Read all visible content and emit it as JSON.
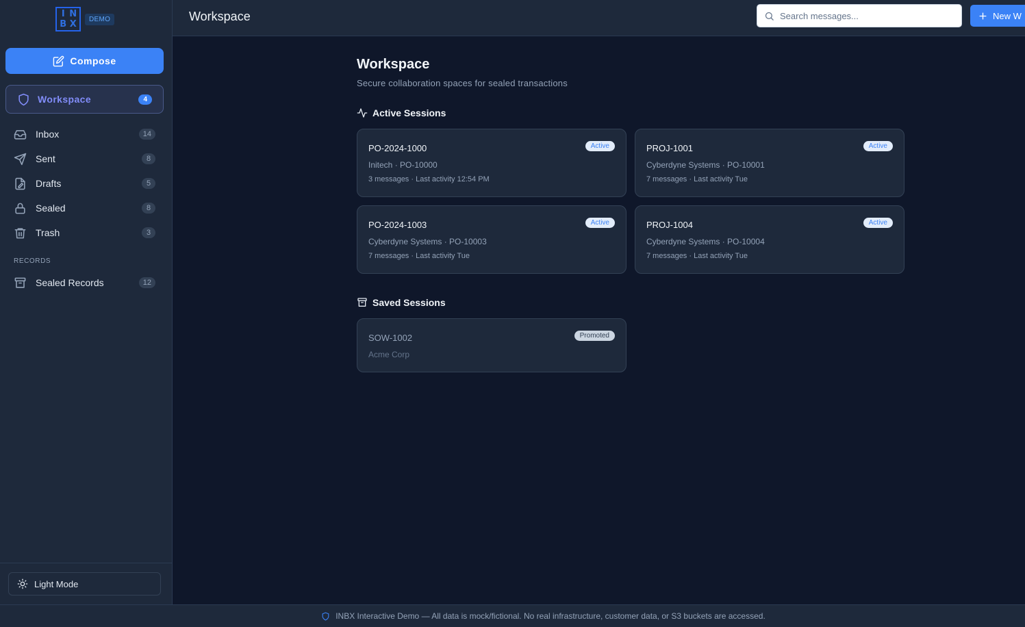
{
  "sidebar": {
    "logo_letters": [
      "I",
      "N",
      "B",
      "X"
    ],
    "demo_badge": "DEMO",
    "compose_label": "Compose",
    "workspace": {
      "label": "Workspace",
      "count": "4"
    },
    "items": [
      {
        "label": "Inbox",
        "count": "14",
        "icon": "inbox-icon"
      },
      {
        "label": "Sent",
        "count": "8",
        "icon": "send-icon"
      },
      {
        "label": "Drafts",
        "count": "5",
        "icon": "draft-icon"
      },
      {
        "label": "Sealed",
        "count": "8",
        "icon": "lock-icon"
      },
      {
        "label": "Trash",
        "count": "3",
        "icon": "trash-icon"
      }
    ],
    "records_header": "RECORDS",
    "records": [
      {
        "label": "Sealed Records",
        "count": "12",
        "icon": "archive-icon"
      }
    ],
    "theme_toggle_label": "Light Mode"
  },
  "header": {
    "title": "Workspace",
    "search_placeholder": "Search messages...",
    "new_button_label": "New W"
  },
  "main": {
    "title": "Workspace",
    "subtitle": "Secure collaboration spaces for sealed transactions",
    "active_header": "Active Sessions",
    "active_sessions": [
      {
        "title": "PO-2024-1000",
        "meta1": "Initech · PO-10000",
        "meta2": "3 messages · Last activity 12:54 PM",
        "badge": "Active"
      },
      {
        "title": "PROJ-1001",
        "meta1": "Cyberdyne Systems · PO-10001",
        "meta2": "7 messages · Last activity Tue",
        "badge": "Active"
      },
      {
        "title": "PO-2024-1003",
        "meta1": "Cyberdyne Systems · PO-10003",
        "meta2": "7 messages · Last activity Tue",
        "badge": "Active"
      },
      {
        "title": "PROJ-1004",
        "meta1": "Cyberdyne Systems · PO-10004",
        "meta2": "7 messages · Last activity Tue",
        "badge": "Active"
      }
    ],
    "saved_header": "Saved Sessions",
    "saved_sessions": [
      {
        "title": "SOW-1002",
        "meta1": "Acme Corp",
        "badge": "Promoted"
      }
    ]
  },
  "banner": {
    "text": "INBX Interactive Demo — All data is mock/fictional. No real infrastructure, customer data, or S3 buckets are accessed."
  },
  "colors": {
    "accent": "#3b82f6",
    "workspace_label": "#818cf8",
    "background": "#0f172a",
    "surface": "#1e293b"
  }
}
